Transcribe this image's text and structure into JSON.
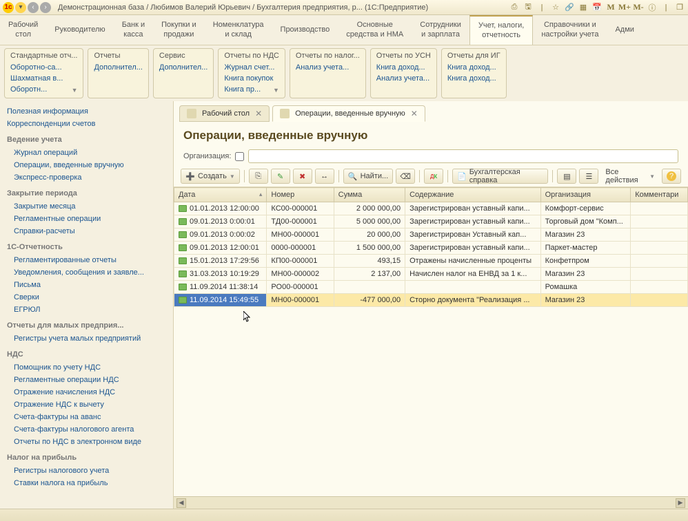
{
  "titlebar": {
    "text": "Демонстрационная база / Любимов Валерий Юрьевич / Бухгалтерия предприятия, р... (1С:Предприятие)",
    "m1": "M",
    "m2": "M+",
    "m3": "M-"
  },
  "menu": [
    "Рабочий\nстол",
    "Руководителю",
    "Банк и\nкасса",
    "Покупки и\nпродажи",
    "Номенклатура\nи склад",
    "Производство",
    "Основные\nсредства и НМА",
    "Сотрудники\nи зарплата",
    "Учет, налоги,\nотчетность",
    "Справочники и\nнастройки учета",
    "Адми"
  ],
  "panels": [
    {
      "title": "Стандартные отч...",
      "items": [
        "Оборотно-са...",
        "Шахматная в...",
        "Оборотн..."
      ],
      "dd": true
    },
    {
      "title": "Отчеты",
      "items": [
        "Дополнител..."
      ]
    },
    {
      "title": "Сервис",
      "items": [
        "Дополнител..."
      ]
    },
    {
      "title": "Отчеты по НДС",
      "items": [
        "Журнал счет...",
        "Книга покупок",
        "Книга пр..."
      ],
      "dd": true
    },
    {
      "title": "Отчеты по налог...",
      "items": [
        "Анализ учета..."
      ]
    },
    {
      "title": "Отчеты по УСН",
      "items": [
        "Книга доход...",
        "Анализ учета..."
      ]
    },
    {
      "title": "Отчеты для ИГ",
      "items": [
        "Книга доход...",
        "Книга доход..."
      ]
    }
  ],
  "nav": [
    {
      "type": "link",
      "text": "Полезная информация"
    },
    {
      "type": "link",
      "text": "Корреспонденции счетов"
    },
    {
      "type": "head",
      "text": "Ведение учета"
    },
    {
      "type": "sub",
      "text": "Журнал операций"
    },
    {
      "type": "sub",
      "text": "Операции, введенные вручную"
    },
    {
      "type": "sub",
      "text": "Экспресс-проверка"
    },
    {
      "type": "head",
      "text": "Закрытие периода"
    },
    {
      "type": "sub",
      "text": "Закрытие месяца"
    },
    {
      "type": "sub",
      "text": "Регламентные операции"
    },
    {
      "type": "sub",
      "text": "Справки-расчеты"
    },
    {
      "type": "head",
      "text": "1С-Отчетность"
    },
    {
      "type": "sub",
      "text": "Регламентированные отчеты"
    },
    {
      "type": "sub",
      "text": "Уведомления, сообщения и заявле..."
    },
    {
      "type": "sub",
      "text": "Письма"
    },
    {
      "type": "sub",
      "text": "Сверки"
    },
    {
      "type": "sub",
      "text": "ЕГРЮЛ"
    },
    {
      "type": "head",
      "text": "Отчеты для малых предприя..."
    },
    {
      "type": "sub",
      "text": "Регистры учета малых предприятий"
    },
    {
      "type": "head",
      "text": "НДС"
    },
    {
      "type": "sub",
      "text": "Помощник по учету НДС"
    },
    {
      "type": "sub",
      "text": "Регламентные операции НДС"
    },
    {
      "type": "sub",
      "text": "Отражение начисления НДС"
    },
    {
      "type": "sub",
      "text": "Отражение НДС к вычету"
    },
    {
      "type": "sub",
      "text": "Счета-фактуры на аванс"
    },
    {
      "type": "sub",
      "text": "Счета-фактуры налогового агента"
    },
    {
      "type": "sub",
      "text": "Отчеты по НДС в электронном виде"
    },
    {
      "type": "head",
      "text": "Налог на прибыль"
    },
    {
      "type": "sub",
      "text": "Регистры налогового учета"
    },
    {
      "type": "sub",
      "text": "Ставки налога на прибыль"
    }
  ],
  "tabs": [
    {
      "label": "Рабочий стол",
      "active": false
    },
    {
      "label": "Операции, введенные вручную",
      "active": true
    }
  ],
  "page": {
    "title": "Операции, введенные вручную",
    "org_label": "Организация:"
  },
  "toolbar": {
    "create": "Создать",
    "find": "Найти...",
    "spravka": "Бухгалтерская справка",
    "all_actions": "Все действия"
  },
  "columns": [
    "Дата",
    "Номер",
    "Сумма",
    "Содержание",
    "Организация",
    "Комментари"
  ],
  "rows": [
    {
      "date": "01.01.2013 12:00:00",
      "num": "КС00-000001",
      "sum": "2 000 000,00",
      "desc": "Зарегистрирован уставный капи...",
      "org": "Комфорт-сервис"
    },
    {
      "date": "09.01.2013 0:00:01",
      "num": "ТД00-000001",
      "sum": "5 000 000,00",
      "desc": "Зарегистрирован уставный капи...",
      "org": "Торговый дом \"Комп..."
    },
    {
      "date": "09.01.2013 0:00:02",
      "num": "МН00-000001",
      "sum": "20 000,00",
      "desc": "Зарегистрирован Уставный кап...",
      "org": "Магазин 23"
    },
    {
      "date": "09.01.2013 12:00:01",
      "num": "0000-000001",
      "sum": "1 500 000,00",
      "desc": "Зарегистрирован уставный капи...",
      "org": "Паркет-мастер"
    },
    {
      "date": "15.01.2013 17:29:56",
      "num": "КП00-000001",
      "sum": "493,15",
      "desc": "Отражены начисленные проценты",
      "org": "Конфетпром"
    },
    {
      "date": "31.03.2013 10:19:29",
      "num": "МН00-000002",
      "sum": "2 137,00",
      "desc": "Начислен налог на ЕНВД за 1 к...",
      "org": "Магазин 23"
    },
    {
      "date": "11.09.2014 11:38:14",
      "num": "РО00-000001",
      "sum": "",
      "desc": "",
      "org": "Ромашка"
    },
    {
      "date": "11.09.2014 15:49:55",
      "num": "МН00-000001",
      "sum": "-477 000,00",
      "desc": "Сторно документа \"Реализация ...",
      "org": "Магазин 23",
      "selected": true,
      "neg": true
    }
  ]
}
